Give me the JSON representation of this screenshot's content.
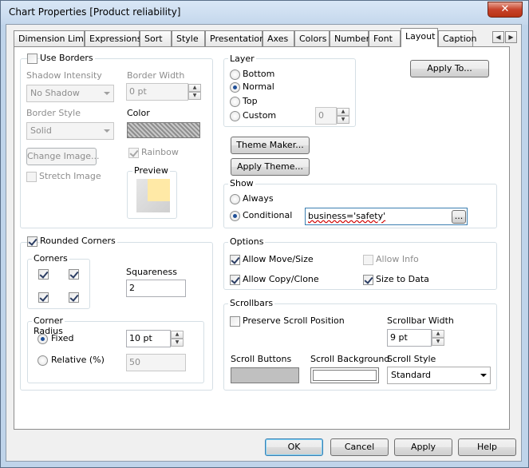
{
  "window": {
    "title": "Chart Properties [Product reliability]",
    "close_glyph": "✕"
  },
  "tabs": [
    {
      "label": "Dimension Limits"
    },
    {
      "label": "Expressions"
    },
    {
      "label": "Sort"
    },
    {
      "label": "Style"
    },
    {
      "label": "Presentation"
    },
    {
      "label": "Axes"
    },
    {
      "label": "Colors"
    },
    {
      "label": "Number"
    },
    {
      "label": "Font"
    },
    {
      "label": "Layout"
    },
    {
      "label": "Caption"
    }
  ],
  "tab_scroll": {
    "left": "◀",
    "right": "▶"
  },
  "borders": {
    "use_borders_label": "Use Borders",
    "shadow_intensity_label": "Shadow Intensity",
    "shadow_intensity_value": "No Shadow",
    "border_width_label": "Border Width",
    "border_width_value": "0 pt",
    "border_style_label": "Border Style",
    "border_style_value": "Solid",
    "color_label": "Color",
    "change_image_label": "Change Image...",
    "rainbow_label": "Rainbow",
    "stretch_image_label": "Stretch Image",
    "preview_label": "Preview"
  },
  "layer": {
    "title": "Layer",
    "options": [
      "Bottom",
      "Normal",
      "Top",
      "Custom"
    ],
    "selected": "Normal",
    "custom_value": "0"
  },
  "apply_to_label": "Apply To...",
  "theme_maker_label": "Theme Maker...",
  "apply_theme_label": "Apply Theme...",
  "show": {
    "title": "Show",
    "always_label": "Always",
    "conditional_label": "Conditional",
    "condition_value": "business='safety'",
    "ellipsis_label": "..."
  },
  "rounded": {
    "rounded_corners_label": "Rounded Corners",
    "corners_title": "Corners",
    "squareness_label": "Squareness",
    "squareness_value": "2",
    "corner_radius_title": "Corner Radius",
    "fixed_label": "Fixed",
    "fixed_value": "10 pt",
    "relative_label": "Relative (%)",
    "relative_value": "50"
  },
  "options": {
    "title": "Options",
    "allow_move_size": "Allow Move/Size",
    "allow_info": "Allow Info",
    "allow_copy_clone": "Allow Copy/Clone",
    "size_to_data": "Size to Data"
  },
  "scrollbars": {
    "title": "Scrollbars",
    "preserve_label": "Preserve Scroll Position",
    "width_label": "Scrollbar Width",
    "width_value": "9 pt",
    "buttons_label": "Scroll Buttons",
    "background_label": "Scroll Background",
    "style_label": "Scroll Style",
    "style_value": "Standard",
    "button_color": "#c0c0c0",
    "background_color": "#ffffff"
  },
  "footer": {
    "ok": "OK",
    "cancel": "Cancel",
    "apply": "Apply",
    "help": "Help"
  }
}
